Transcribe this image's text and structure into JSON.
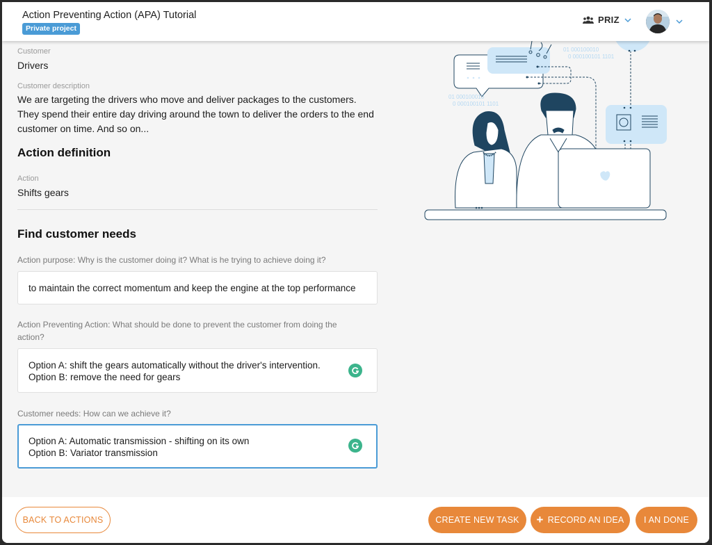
{
  "header": {
    "title": "Action Preventing Action (APA) Tutorial",
    "badge": "Private project",
    "team_name": "PRIZ",
    "team_icon": "users-icon",
    "avatar_icon": "user-avatar"
  },
  "customer": {
    "label": "Customer",
    "value": "Drivers",
    "description_label": "Customer description",
    "description": "We are targeting the drivers who move and deliver packages to the customers. They spend their entire day driving around the town to deliver the orders to the end customer on time. And so on..."
  },
  "action_definition": {
    "title": "Action definition",
    "action_label": "Action",
    "action_value": "Shifts gears"
  },
  "customer_needs": {
    "title": "Find customer needs",
    "purpose_label": "Action purpose: Why is the customer doing it? What is he trying to achieve doing it?",
    "purpose_value": "to maintain the correct momentum and keep the engine at the top performance",
    "apa_label": "Action Preventing Action: What should be done to prevent the customer from doing the action?",
    "apa_line1": "Option A: shift the gears automatically without the driver's intervention.",
    "apa_line2": "Option B: remove the need for gears",
    "needs_label": "Customer needs: How can we achieve it?",
    "needs_line1": "Option A: Automatic transmission - shifting on its own",
    "needs_line2": "Option B: Variator transmission"
  },
  "illustration": {
    "binary_1a": "01   000100010",
    "binary_1b": "0  000100101   1101",
    "binary_2a": "01   000100010",
    "binary_2b": "0  000100101   1101"
  },
  "footer": {
    "back_label": "BACK TO ACTIONS",
    "create_task_label": "CREATE NEW TASK",
    "record_idea_label": "RECORD AN IDEA",
    "record_idea_icon": "+",
    "done_label": "I AN DONE"
  },
  "colors": {
    "accent": "#e8883a",
    "badge": "#4a9bd6",
    "focus": "#4a9bd6",
    "grammarly": "#3cb48c",
    "illus_dark": "#1f4560",
    "illus_light": "#cfe7f8"
  }
}
